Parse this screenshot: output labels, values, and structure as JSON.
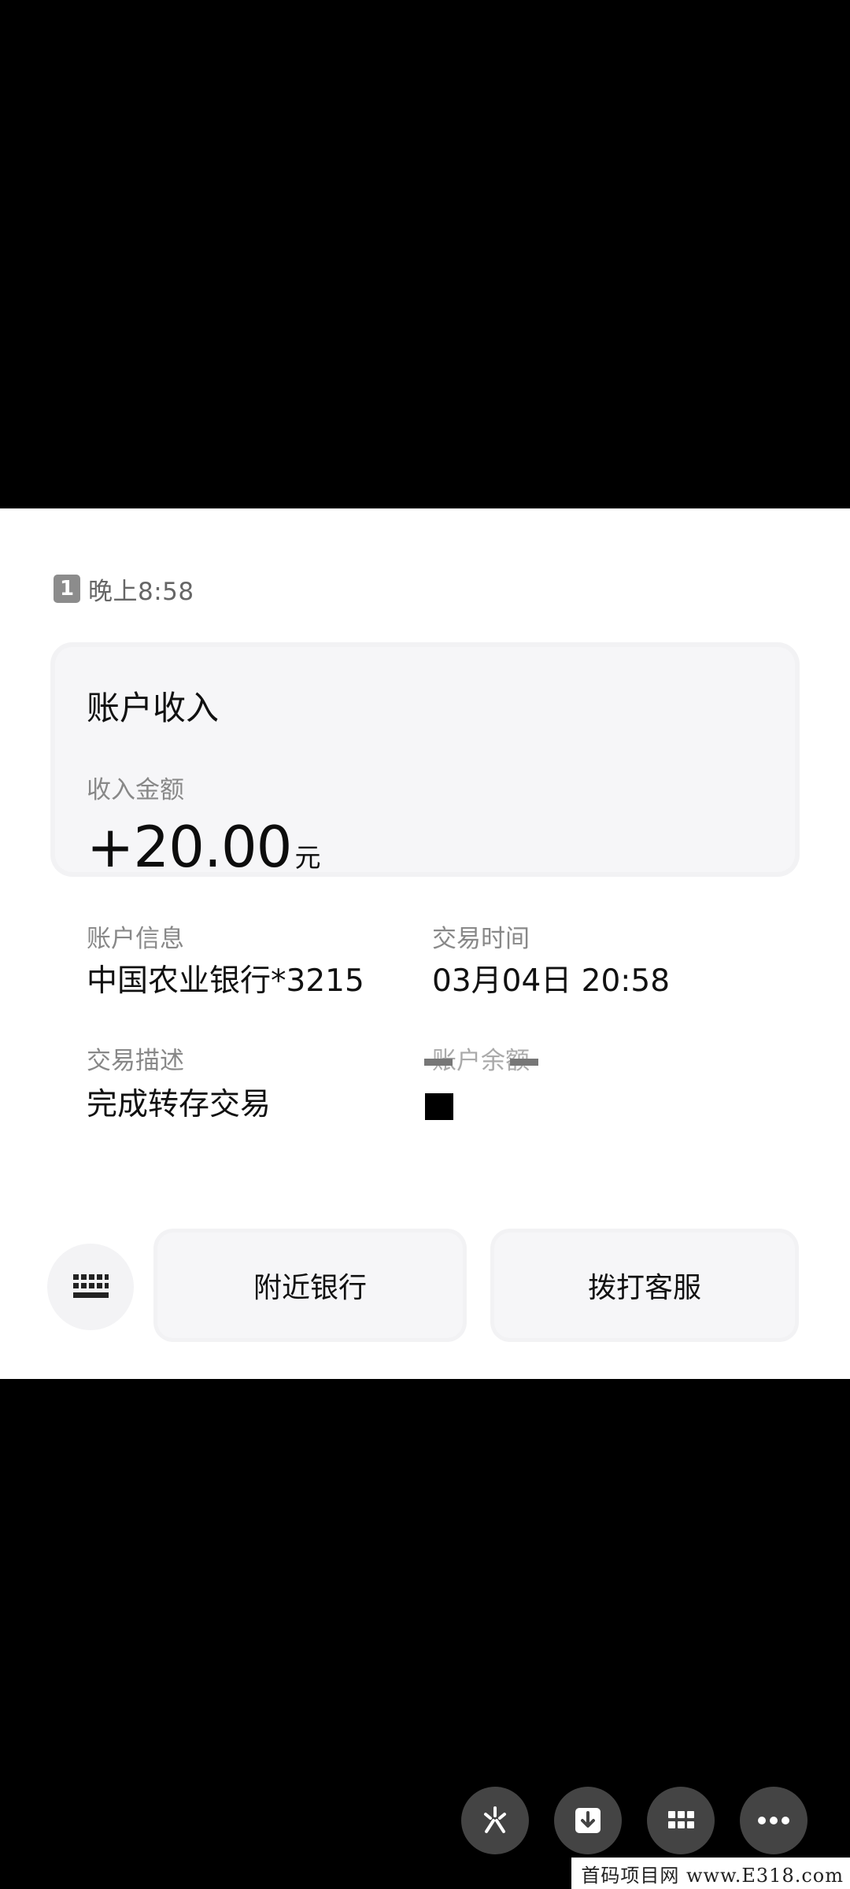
{
  "message": {
    "sim_slot": "1",
    "time": "晚上8:58"
  },
  "card": {
    "title": "账户收入",
    "amount_label": "收入金额",
    "amount": "+20.00",
    "amount_unit": "元",
    "account_label": "账户信息",
    "account_value": "中国农业银行*3215",
    "time_label": "交易时间",
    "time_value": "03月04日 20:58",
    "desc_label": "交易描述",
    "desc_value": "完成转存交易",
    "balance_label": "账户余额"
  },
  "actions": {
    "nearby_bank": "附近银行",
    "call_service": "拨打客服"
  },
  "icons": {
    "keyboard": "keyboard-icon",
    "sparkle": "sparkle-icon",
    "download": "download-icon",
    "apps": "apps-grid-icon",
    "more": "more-icon"
  },
  "watermark": "首码项目网 www.E318.com"
}
